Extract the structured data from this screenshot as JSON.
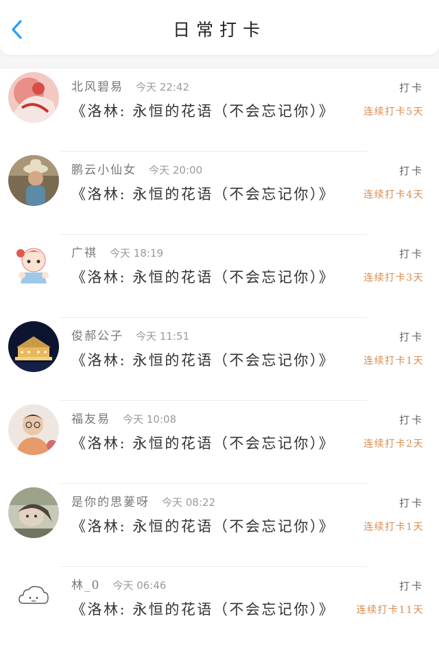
{
  "header": {
    "title": "日常打卡",
    "back_icon": "chevron-left-icon",
    "accent_color": "#2d9cf0"
  },
  "entries": [
    {
      "user": "北风碧易",
      "time": "今天 22:42",
      "book": "《洛林: 永恒的花语（不会忘记你）》",
      "action": "打卡",
      "streak": "连续打卡5天"
    },
    {
      "user": "鹏云小仙女",
      "time": "今天 20:00",
      "book": "《洛林: 永恒的花语（不会忘记你）》",
      "action": "打卡",
      "streak": "连续打卡4天"
    },
    {
      "user": "广祺",
      "time": "今天 18:19",
      "book": "《洛林: 永恒的花语（不会忘记你）》",
      "action": "打卡",
      "streak": "连续打卡3天"
    },
    {
      "user": "俊郝公子",
      "time": "今天 11:51",
      "book": "《洛林: 永恒的花语（不会忘记你）》",
      "action": "打卡",
      "streak": "连续打卡1天"
    },
    {
      "user": "福友易",
      "time": "今天 10:08",
      "book": "《洛林: 永恒的花语（不会忘记你）》",
      "action": "打卡",
      "streak": "连续打卡2天"
    },
    {
      "user": "是你的思蓌呀",
      "time": "今天 08:22",
      "book": "《洛林: 永恒的花语（不会忘记你）》",
      "action": "打卡",
      "streak": "连续打卡1天"
    },
    {
      "user": "林_0",
      "time": "今天 06:46",
      "book": "《洛林: 永恒的花语（不会忘记你）》",
      "action": "打卡",
      "streak": "连续打卡11天"
    }
  ],
  "colors": {
    "streak": "#d98a4e",
    "background": "#f6f6f7"
  }
}
